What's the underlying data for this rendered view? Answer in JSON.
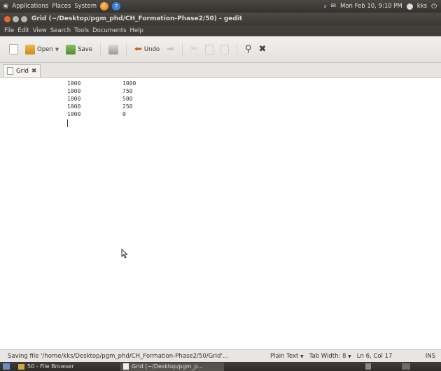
{
  "top_panel": {
    "menus": [
      "Applications",
      "Places",
      "System"
    ],
    "datetime": "Mon Feb 10,  9:10 PM",
    "user": "kks"
  },
  "window": {
    "title": "Grid (~/Desktop/pgm_phd/CH_Formation-Phase2/50) - gedit"
  },
  "menubar": [
    "File",
    "Edit",
    "View",
    "Search",
    "Tools",
    "Documents",
    "Help"
  ],
  "toolbar": {
    "open_label": "Open",
    "save_label": "Save",
    "undo_label": "Undo"
  },
  "tab": {
    "label": "Grid"
  },
  "editor": {
    "lines": [
      [
        "1000",
        "1000"
      ],
      [
        "1000",
        "750"
      ],
      [
        "1000",
        "500"
      ],
      [
        "1000",
        "250"
      ],
      [
        "1000",
        "0"
      ]
    ]
  },
  "statusbar": {
    "message": "Saving file '/home/kks/Desktop/pgm_phd/CH_Formation-Phase2/50/Grid'...",
    "mode": "Plain Text",
    "tab_width": "Tab Width: 8",
    "position": "Ln 6, Col 17",
    "ins": "INS"
  },
  "taskbar": {
    "tasks": [
      "50 - File Browser",
      "Grid (~/Desktop/pgm_p..."
    ]
  }
}
